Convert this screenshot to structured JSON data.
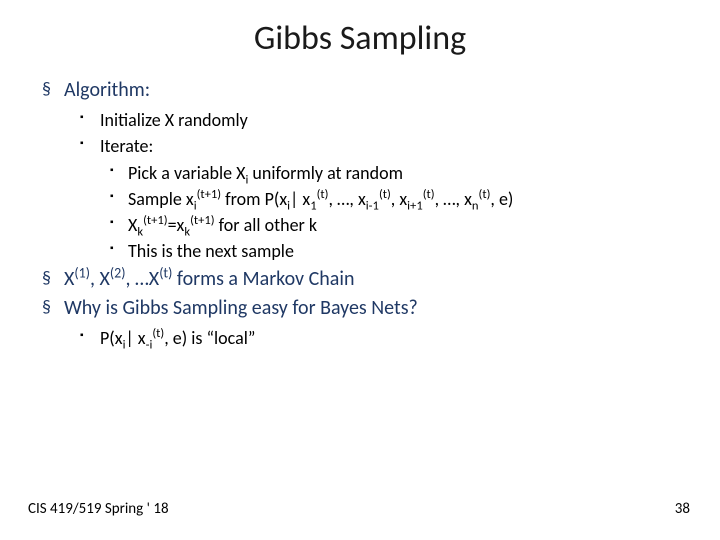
{
  "title": "Gibbs Sampling",
  "b1": {
    "algorithm": "Algorithm:",
    "initialize": "Initialize X randomly",
    "iterate": "Iterate:",
    "pick": "Pick a variable X_i uniformly at random",
    "sample": "Sample x_i^(t+1) from P(x_i | x_1^(t), …, x_{i-1}^(t), x_{i+1}^(t), …, x_n^(t), e)",
    "xk": "X_k^(t+1) = x_k^(t+1) for all other k",
    "next_sample": "This is the next sample"
  },
  "b2": {
    "markov": "X^(1), X^(2), …X^(t) forms a Markov Chain",
    "why": "Why is Gibbs Sampling easy for Bayes Nets?",
    "local": "P(x_i | x_{-i}^(t), e) is \"local\""
  },
  "footer": {
    "left": "CIS 419/519 Spring ' 18",
    "right": "38"
  }
}
